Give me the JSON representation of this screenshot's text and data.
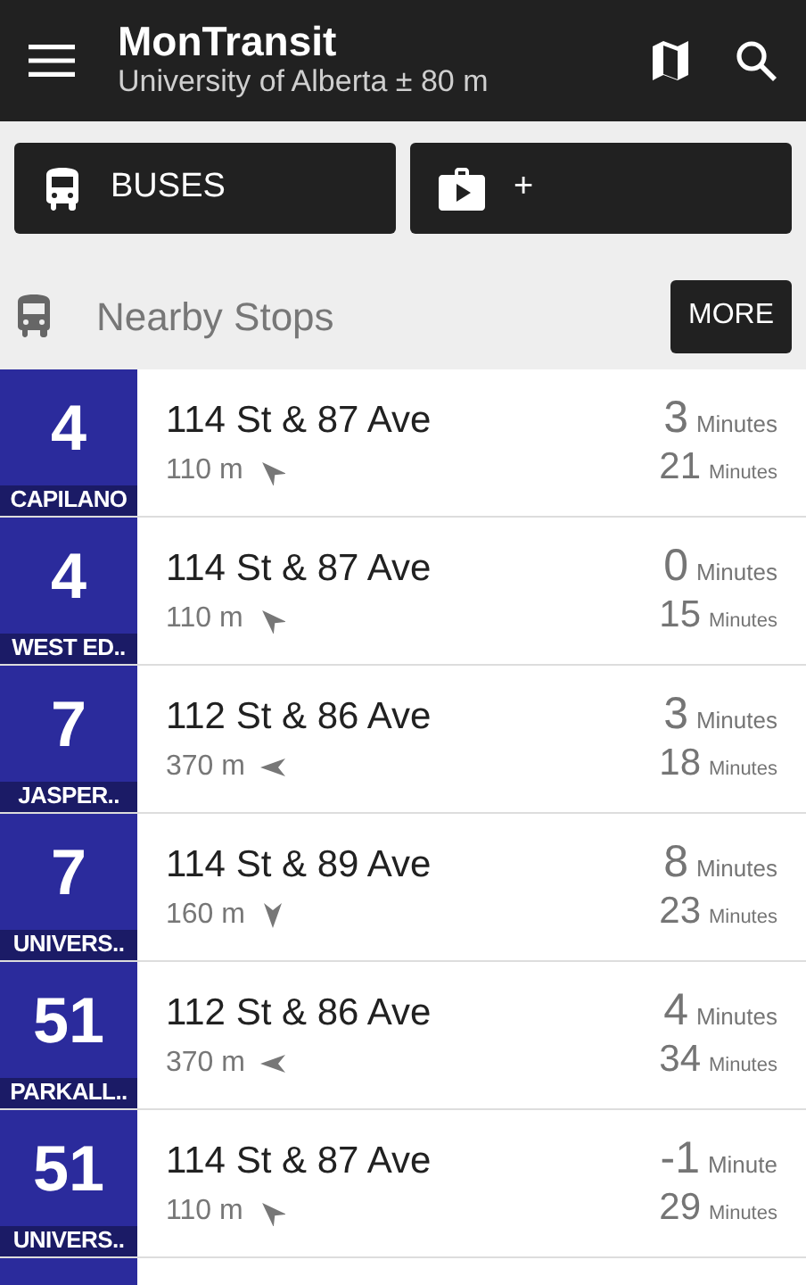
{
  "app_bar": {
    "title": "MonTransit",
    "subtitle": "University of Alberta ± 80 m"
  },
  "shortcuts": [
    {
      "kind": "bus",
      "label": "BUSES"
    },
    {
      "kind": "store",
      "label": "+"
    }
  ],
  "section": {
    "title": "Nearby Stops",
    "button": "MORE"
  },
  "stops": [
    {
      "route": "4",
      "headsign": "CAPILANO",
      "stop": "114 St & 87 Ave",
      "distance": "110 m",
      "kind": "northwest",
      "times": [
        {
          "value": "3",
          "unit": "Minutes"
        },
        {
          "value": "21",
          "unit": "Minutes"
        }
      ]
    },
    {
      "route": "4",
      "headsign": "WEST ED..",
      "stop": "114 St & 87 Ave",
      "distance": "110 m",
      "kind": "northwest",
      "times": [
        {
          "value": "0",
          "unit": "Minutes"
        },
        {
          "value": "15",
          "unit": "Minutes"
        }
      ]
    },
    {
      "route": "7",
      "headsign": "JASPER..",
      "stop": "112 St & 86 Ave",
      "distance": "370 m",
      "kind": "west",
      "times": [
        {
          "value": "3",
          "unit": "Minutes"
        },
        {
          "value": "18",
          "unit": "Minutes"
        }
      ]
    },
    {
      "route": "7",
      "headsign": "UNIVERS..",
      "stop": "114 St & 89 Ave",
      "distance": "160 m",
      "kind": "south",
      "times": [
        {
          "value": "8",
          "unit": "Minutes"
        },
        {
          "value": "23",
          "unit": "Minutes"
        }
      ]
    },
    {
      "route": "51",
      "headsign": "PARKALL..",
      "stop": "112 St & 86 Ave",
      "distance": "370 m",
      "kind": "west",
      "times": [
        {
          "value": "4",
          "unit": "Minutes"
        },
        {
          "value": "34",
          "unit": "Minutes"
        }
      ]
    },
    {
      "route": "51",
      "headsign": "UNIVERS..",
      "stop": "114 St & 87 Ave",
      "distance": "110 m",
      "kind": "northwest",
      "times": [
        {
          "value": "-1",
          "unit": "Minute"
        },
        {
          "value": "29",
          "unit": "Minutes"
        }
      ]
    }
  ]
}
